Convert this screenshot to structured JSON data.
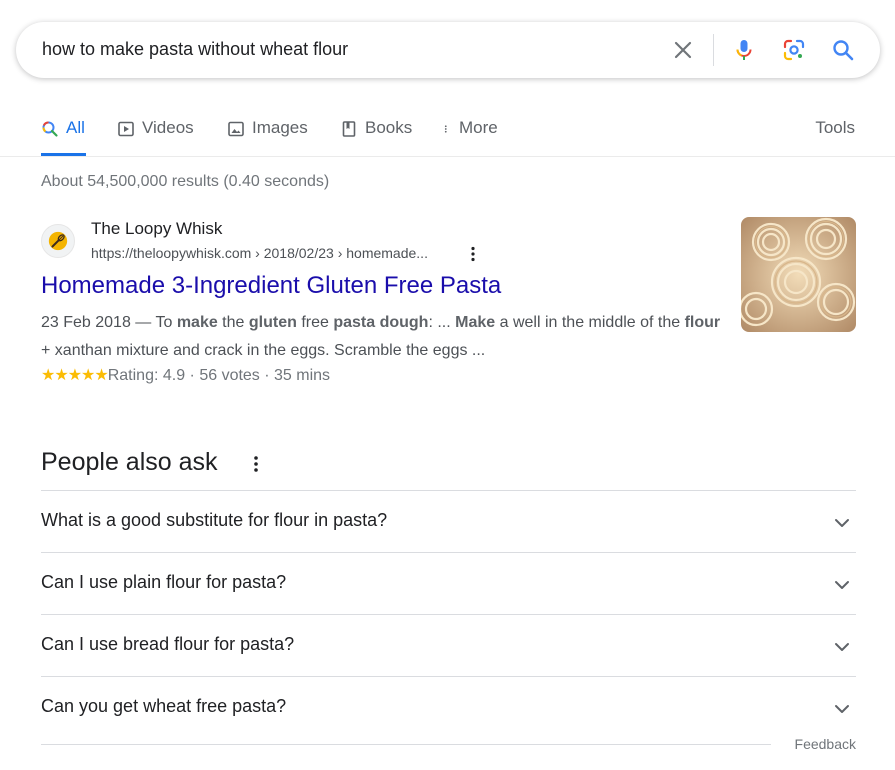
{
  "search": {
    "query": "how to make pasta without wheat flour"
  },
  "tabs": [
    {
      "label": "All",
      "icon": "search-color-icon",
      "active": true
    },
    {
      "label": "Videos",
      "icon": "play-box-icon"
    },
    {
      "label": "Images",
      "icon": "image-icon"
    },
    {
      "label": "Books",
      "icon": "book-icon"
    },
    {
      "label": "More",
      "icon": "vertical-dots-icon"
    }
  ],
  "tools_label": "Tools",
  "result_stats": "About 54,500,000 results (0.40 seconds)",
  "result": {
    "site_name": "The Loopy Whisk",
    "url": "https://theloopywhisk.com › 2018/02/23 › homemade...",
    "title": "Homemade 3-Ingredient Gluten Free Pasta",
    "date": "23 Feb 2018",
    "snippet_parts": [
      " — To ",
      "make",
      " the ",
      "gluten",
      " free ",
      "pasta dough",
      ": ... ",
      "Make",
      " a well in the middle of the ",
      "flour",
      " + xanthan mixture and crack in the eggs. Scramble the eggs ..."
    ],
    "stars": "★★★★★",
    "rating_text": "Rating: 4.9 · 56 votes · 35 mins",
    "rating_value": 4.9
  },
  "paa": {
    "heading": "People also ask",
    "questions": [
      "What is a good substitute for flour in pasta?",
      "Can I use plain flour for pasta?",
      "Can I use bread flour for pasta?",
      "Can you get wheat free pasta?"
    ]
  },
  "feedback_label": "Feedback",
  "colors": {
    "link": "#1a0dab",
    "accent": "#1a73e8",
    "star": "#fbbc04"
  }
}
